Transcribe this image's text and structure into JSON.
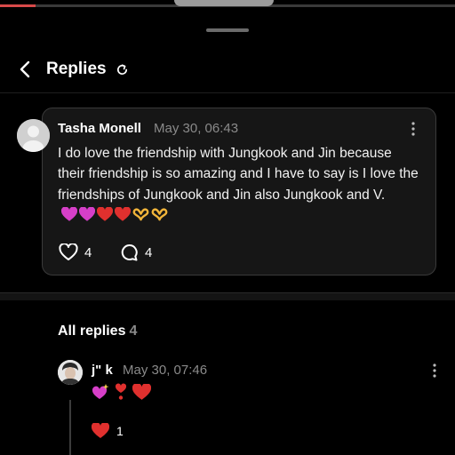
{
  "header": {
    "title": "Replies"
  },
  "post": {
    "author": "Tasha Monell",
    "timestamp": "May 30, 06:43",
    "text": "I do love the friendship with Jungkook and Jin because their friendship is so amazing and I have to say is I love the friendships of Jungkook and Jin also Jungkook and V.",
    "emojis": [
      "purple-heart",
      "purple-heart",
      "red-heart",
      "red-heart",
      "heart-hands",
      "heart-hands"
    ],
    "likes": "4",
    "comments": "4"
  },
  "replies_section": {
    "label": "All replies",
    "count": "4"
  },
  "reply": {
    "author": "j\" k",
    "timestamp": "May 30, 07:46",
    "emojis": [
      "sparkling-heart",
      "heart-exclamation",
      "red-heart"
    ],
    "likes": "1"
  },
  "colors": {
    "background": "#000000",
    "card": "#161616",
    "muted": "#8a8a8a",
    "heart": "#e0302e",
    "pink": "#d63fc8"
  }
}
